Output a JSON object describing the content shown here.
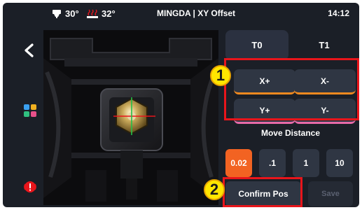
{
  "status_bar": {
    "nozzle_temp": "30°",
    "bed_temp": "32°",
    "title": "MINGDA | XY Offset",
    "time": "14:12"
  },
  "tabs": [
    {
      "label": "T0",
      "selected": true
    },
    {
      "label": "T1",
      "selected": false
    }
  ],
  "jog_buttons": {
    "x_plus": "X+",
    "x_minus": "X-",
    "y_plus": "Y+",
    "y_minus": "Y-"
  },
  "move_distance": {
    "label": "Move Distance",
    "options": [
      "0.02",
      ".1",
      "1",
      "10"
    ],
    "selected": "0.02"
  },
  "actions": {
    "confirm_label": "Confirm Pos",
    "save_label": "Save"
  },
  "annotations": {
    "badge_1": "1",
    "badge_2": "2"
  },
  "icons": {
    "back": "chevron-left-icon",
    "nozzle": "nozzle-icon",
    "bed": "heated-bed-icon",
    "apps": "apps-grid-icon",
    "alert": "alert-icon"
  },
  "colors": {
    "background": "#1b1f27",
    "button": "#2f3643",
    "accent_orange": "#f26322",
    "x_underline": "#f0891f",
    "y_underline": "#e86aa8",
    "annotation_red": "#e8151b",
    "badge_yellow": "#ffe600"
  }
}
